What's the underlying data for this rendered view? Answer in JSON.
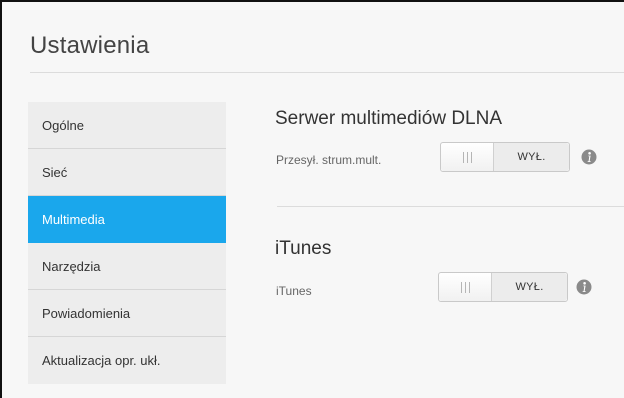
{
  "header": {
    "title": "Ustawienia"
  },
  "sidebar": {
    "items": [
      {
        "label": "Ogólne",
        "active": false
      },
      {
        "label": "Sieć",
        "active": false
      },
      {
        "label": "Multimedia",
        "active": true
      },
      {
        "label": "Narzędzia",
        "active": false
      },
      {
        "label": "Powiadomienia",
        "active": false
      },
      {
        "label": "Aktualizacja opr. ukł.",
        "active": false
      }
    ]
  },
  "sections": {
    "dlna": {
      "title": "Serwer multimediów DLNA",
      "row_label": "Przesył. strum.mult.",
      "toggle_state": "WYŁ.",
      "info_icon": "info-icon"
    },
    "itunes": {
      "title": "iTunes",
      "row_label": "iTunes",
      "toggle_state": "WYŁ.",
      "info_icon": "info-icon"
    }
  },
  "colors": {
    "accent": "#1aa7ec",
    "sidebar_bg": "#ededed",
    "page_bg": "#f7f7f7"
  }
}
